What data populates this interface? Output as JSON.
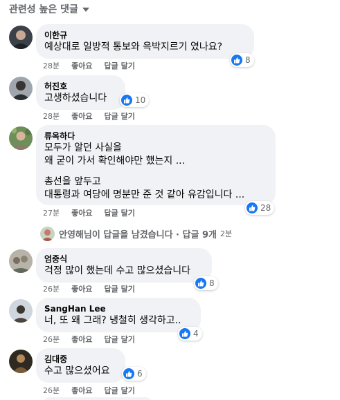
{
  "sort": {
    "label": "관련성 높은 댓글"
  },
  "colors": {
    "like_blue": "#1877f2",
    "bubble_bg": "#f0f2f5",
    "meta_gray": "#65676b"
  },
  "comments": [
    {
      "author": "이한규",
      "lines": [
        "예상대로 일방적 통보와 윽박지르기 였나요?"
      ],
      "likes": "8",
      "time": "28분",
      "like_label": "좋아요",
      "reply_label": "답글 달기"
    },
    {
      "author": "허진호",
      "lines": [
        "고생하셨습니다"
      ],
      "likes": "10",
      "time": "28분",
      "like_label": "좋아요",
      "reply_label": "답글 달기"
    },
    {
      "author": "류옥하다",
      "lines": [
        "모두가 알던 사실을",
        "왜 굳이 가서 확인해야만 했는지 ...",
        "",
        "총선을 앞두고",
        "대통령과 여당에 명분만 준 것 같아 유감입니다 ..."
      ],
      "likes": "28",
      "time": "27분",
      "like_label": "좋아요",
      "reply_label": "답글 달기"
    },
    {
      "author": "엄중식",
      "lines": [
        "걱정 많이 했는데 수고 많으셨습니다"
      ],
      "likes": "8",
      "time": "26분",
      "like_label": "좋아요",
      "reply_label": "답글 달기"
    },
    {
      "author": "SangHan Lee",
      "lines": [
        "너, 또 왜 그래? 냉철히 생각하고.."
      ],
      "likes": "4",
      "time": "26분",
      "like_label": "좋아요",
      "reply_label": "답글 달기"
    },
    {
      "author": "김대중",
      "lines": [
        "수고 많으셨어요"
      ],
      "likes": "6",
      "time": "26분",
      "like_label": "좋아요",
      "reply_label": "답글 달기"
    }
  ],
  "reply_summary": {
    "text": "안영해님이 답글을 남겼습니다 · 답글 9개",
    "time": "2분"
  }
}
